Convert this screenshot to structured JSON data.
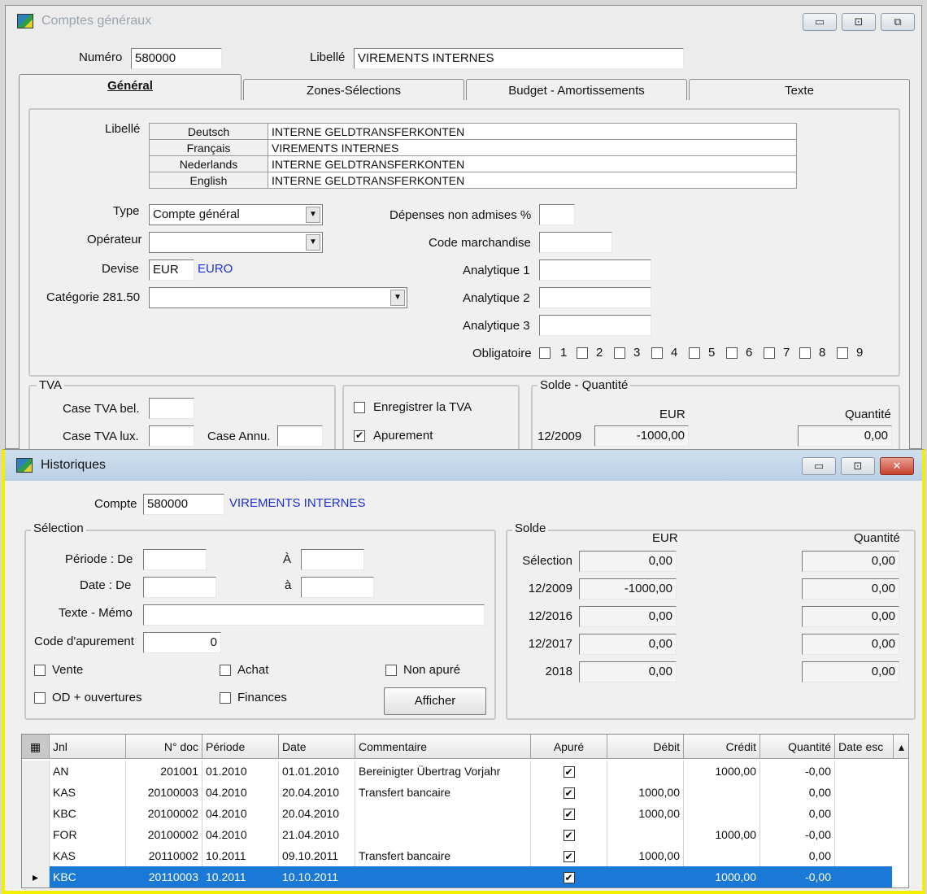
{
  "top_window": {
    "title": "Comptes généraux",
    "numero_label": "Numéro",
    "numero_value": "580000",
    "libelle_label": "Libellé",
    "libelle_value": "VIREMENTS INTERNES",
    "tabs": [
      "Général",
      "Zones-Sélections",
      "Budget - Amortissements",
      "Texte"
    ],
    "libelle_section_label": "Libellé",
    "languages": [
      {
        "lang": "Deutsch",
        "value": "INTERNE GELDTRANSFERKONTEN"
      },
      {
        "lang": "Français",
        "value": "VIREMENTS INTERNES"
      },
      {
        "lang": "Nederlands",
        "value": "INTERNE GELDTRANSFERKONTEN"
      },
      {
        "lang": "English",
        "value": "INTERNE GELDTRANSFERKONTEN"
      }
    ],
    "type_label": "Type",
    "type_value": "Compte général",
    "operateur_label": "Opérateur",
    "operateur_value": "",
    "devise_label": "Devise",
    "devise_value": "EUR",
    "devise_name": "EURO",
    "categorie_label": "Catégorie 281.50",
    "categorie_value": "",
    "depenses_label": "Dépenses non admises %",
    "code_marchandise_label": "Code marchandise",
    "analytique1_label": "Analytique 1",
    "analytique2_label": "Analytique 2",
    "analytique3_label": "Analytique 3",
    "obligatoire_label": "Obligatoire",
    "obligatoire_items": [
      "1",
      "2",
      "3",
      "4",
      "5",
      "6",
      "7",
      "8",
      "9"
    ],
    "tva_group_label": "TVA",
    "case_tva_bel_label": "Case TVA bel.",
    "case_tva_lux_label": "Case TVA lux.",
    "case_annu_label": "Case Annu.",
    "enregistrer_tva_label": "Enregistrer la TVA",
    "apurement_label": "Apurement",
    "solde_group_label": "Solde - Quantité",
    "solde_eur_header": "EUR",
    "solde_qty_header": "Quantité",
    "solde_period": "12/2009",
    "solde_eur_value": "-1000,00",
    "solde_qty_value": "0,00"
  },
  "bottom_window": {
    "title": "Historiques",
    "compte_label": "Compte",
    "compte_value": "580000",
    "compte_name": "VIREMENTS INTERNES",
    "selection_group_label": "Sélection",
    "periode_de_label": "Période : De",
    "periode_a_label": "À",
    "date_de_label": "Date : De",
    "date_a_label": "à",
    "texte_memo_label": "Texte - Mémo",
    "code_apurement_label": "Code d'apurement",
    "code_apurement_value": "0",
    "vente_label": "Vente",
    "achat_label": "Achat",
    "non_apure_label": "Non apuré",
    "od_label": "OD + ouvertures",
    "finances_label": "Finances",
    "afficher_label": "Afficher",
    "solde_group_label": "Solde",
    "eur_header": "EUR",
    "qty_header": "Quantité",
    "solde_rows": [
      {
        "label": "Sélection",
        "eur": "0,00",
        "qty": "0,00"
      },
      {
        "label": "12/2009",
        "eur": "-1000,00",
        "qty": "0,00"
      },
      {
        "label": "12/2016",
        "eur": "0,00",
        "qty": "0,00"
      },
      {
        "label": "12/2017",
        "eur": "0,00",
        "qty": "0,00"
      },
      {
        "label": "2018",
        "eur": "0,00",
        "qty": "0,00"
      }
    ],
    "grid_headers": [
      "Jnl",
      "N° doc",
      "Période",
      "Date",
      "Commentaire",
      "Apuré",
      "Débit",
      "Crédit",
      "Quantité",
      "Date esc"
    ],
    "grid_rows": [
      {
        "jnl": "AN",
        "doc": "201001",
        "periode": "01.2010",
        "date": "01.01.2010",
        "commentaire": "Bereinigter Übertrag Vorjahr",
        "apure": "✔",
        "debit": "",
        "credit": "1000,00",
        "qty": "-0,00"
      },
      {
        "jnl": "KAS",
        "doc": "20100003",
        "periode": "04.2010",
        "date": "20.04.2010",
        "commentaire": "Transfert bancaire",
        "apure": "✔",
        "debit": "1000,00",
        "credit": "",
        "qty": "0,00"
      },
      {
        "jnl": "KBC",
        "doc": "20100002",
        "periode": "04.2010",
        "date": "20.04.2010",
        "commentaire": "",
        "apure": "✔",
        "debit": "1000,00",
        "credit": "",
        "qty": "0,00"
      },
      {
        "jnl": "FOR",
        "doc": "20100002",
        "periode": "04.2010",
        "date": "21.04.2010",
        "commentaire": "",
        "apure": "✔",
        "debit": "",
        "credit": "1000,00",
        "qty": "-0,00"
      },
      {
        "jnl": "KAS",
        "doc": "20110002",
        "periode": "10.2011",
        "date": "09.10.2011",
        "commentaire": "Transfert bancaire",
        "apure": "✔",
        "debit": "1000,00",
        "credit": "",
        "qty": "0,00"
      },
      {
        "jnl": "KBC",
        "doc": "20110003",
        "periode": "10.2011",
        "date": "10.10.2011",
        "commentaire": "",
        "apure": "✔",
        "debit": "",
        "credit": "1000,00",
        "qty": "-0,00"
      }
    ],
    "selected_row_marker": "▸"
  },
  "icons": {
    "minimize": "▭",
    "maximize": "⊡",
    "restore": "⧉",
    "close": "✕",
    "dropdown": "▼",
    "check": "✔",
    "scroll_up": "▴"
  }
}
